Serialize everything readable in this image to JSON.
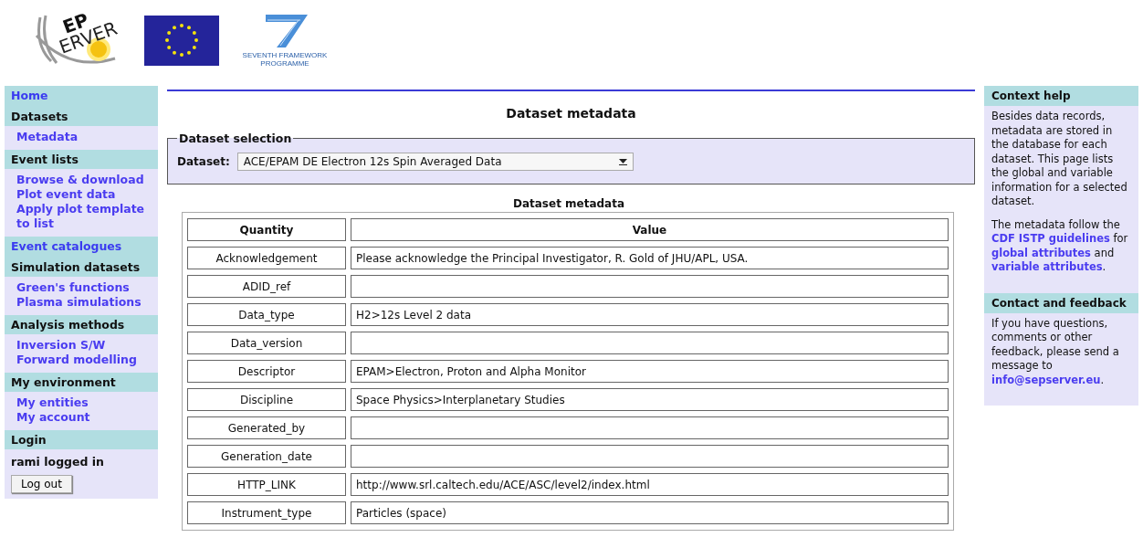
{
  "logos": {
    "sepserver": [
      "EP",
      "ERVER"
    ],
    "fp7_caption": [
      "SEVENTH FRAMEWORK",
      "PROGRAMME"
    ]
  },
  "sidebar": [
    {
      "headers": [
        {
          "text": "Home",
          "kind": "link"
        },
        {
          "text": "Datasets",
          "kind": "heading"
        }
      ],
      "items": [
        "Metadata"
      ]
    },
    {
      "headers": [
        {
          "text": "Event lists",
          "kind": "heading"
        }
      ],
      "items": [
        "Browse & download",
        "Plot event data",
        "Apply plot template to list"
      ]
    },
    {
      "headers": [
        {
          "text": "Event catalogues",
          "kind": "link"
        },
        {
          "text": "Simulation datasets",
          "kind": "heading"
        }
      ],
      "items": [
        "Green's functions",
        "Plasma simulations"
      ]
    },
    {
      "headers": [
        {
          "text": "Analysis methods",
          "kind": "heading"
        }
      ],
      "items": [
        "Inversion S/W",
        "Forward modelling"
      ]
    },
    {
      "headers": [
        {
          "text": "My environment",
          "kind": "heading"
        }
      ],
      "items": [
        "My entities",
        "My account"
      ]
    },
    {
      "headers": [
        {
          "text": "Login",
          "kind": "heading"
        }
      ],
      "status": "rami logged in",
      "button": "Log out"
    }
  ],
  "main": {
    "title": "Dataset metadata",
    "selection": {
      "legend": "Dataset selection",
      "label": "Dataset:",
      "value": "ACE/EPAM DE Electron 12s Spin Averaged Data"
    },
    "table": {
      "caption": "Dataset metadata",
      "columns": [
        "Quantity",
        "Value"
      ],
      "rows": [
        [
          "Acknowledgement",
          "Please acknowledge the Principal Investigator, R. Gold of JHU/APL, USA."
        ],
        [
          "ADID_ref",
          ""
        ],
        [
          "Data_type",
          "H2>12s Level 2 data"
        ],
        [
          "Data_version",
          ""
        ],
        [
          "Descriptor",
          "EPAM>Electron, Proton and Alpha Monitor"
        ],
        [
          "Discipline",
          "Space Physics>Interplanetary Studies"
        ],
        [
          "Generated_by",
          ""
        ],
        [
          "Generation_date",
          ""
        ],
        [
          "HTTP_LINK",
          "http://www.srl.caltech.edu/ACE/ASC/level2/index.html"
        ],
        [
          "Instrument_type",
          "Particles (space)"
        ]
      ]
    }
  },
  "help": [
    {
      "title": "Context help",
      "paragraphs": [
        [
          {
            "kind": "text",
            "text": "Besides data records, metadata are stored in the database for each dataset. This page lists the global and variable information for a selected dataset."
          }
        ],
        [
          {
            "kind": "text",
            "text": "The metadata follow the "
          },
          {
            "kind": "link",
            "text": "CDF ISTP guidelines"
          },
          {
            "kind": "text",
            "text": " for "
          },
          {
            "kind": "link",
            "text": "global attributes"
          },
          {
            "kind": "text",
            "text": " and "
          },
          {
            "kind": "link",
            "text": "variable attributes"
          },
          {
            "kind": "text",
            "text": "."
          }
        ]
      ]
    },
    {
      "title": "Contact and feedback",
      "paragraphs": [
        [
          {
            "kind": "text",
            "text": "If you have questions, comments or other feedback, please send a message to "
          },
          {
            "kind": "link",
            "text": "info@sepserver.eu"
          },
          {
            "kind": "text",
            "text": "."
          }
        ]
      ]
    }
  ]
}
